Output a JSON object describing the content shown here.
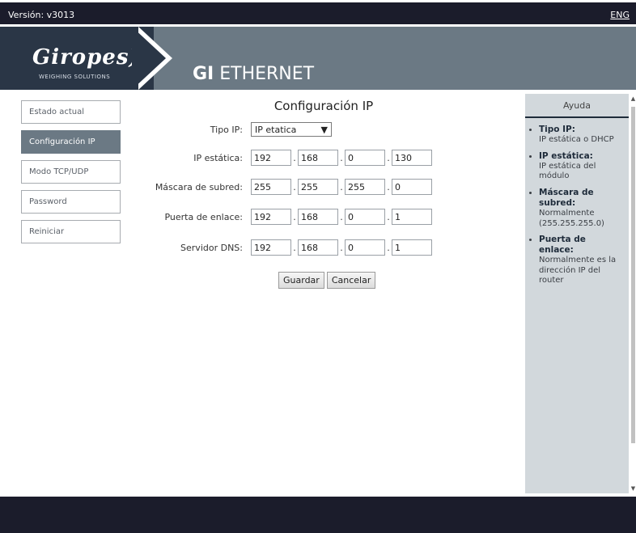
{
  "topbar": {
    "version": "Versión: v3013",
    "lang": "ENG"
  },
  "header": {
    "logo": "Giropes)",
    "logo_sub": "WEIGHING SOLUTIONS",
    "title_bold": "GI",
    "title_rest": " ETHERNET"
  },
  "sidebar": {
    "items": [
      {
        "label": "Estado actual"
      },
      {
        "label": "Configuración IP"
      },
      {
        "label": "Modo TCP/UDP"
      },
      {
        "label": "Password"
      },
      {
        "label": "Reiniciar"
      }
    ]
  },
  "form": {
    "title": "Configuración IP",
    "tipo_label": "Tipo IP:",
    "tipo_value": "IP etatica",
    "ip_label": "IP estática:",
    "ip": [
      "192",
      "168",
      "0",
      "130"
    ],
    "mask_label": "Máscara de subred:",
    "mask": [
      "255",
      "255",
      "255",
      "0"
    ],
    "gw_label": "Puerta de enlace:",
    "gw": [
      "192",
      "168",
      "0",
      "1"
    ],
    "dns_label": "Servidor DNS:",
    "dns": [
      "192",
      "168",
      "0",
      "1"
    ],
    "save": "Guardar",
    "cancel": "Cancelar"
  },
  "help": {
    "title": "Ayuda",
    "items": [
      {
        "term": "Tipo IP:",
        "desc": "IP estática o DHCP"
      },
      {
        "term": "IP estática:",
        "desc": "IP estática del módulo"
      },
      {
        "term": "Máscara de subred:",
        "desc": "Normalmente (255.255.255.0)"
      },
      {
        "term": "Puerta de enlace:",
        "desc": "Normalmente es la dirección IP del router"
      }
    ]
  },
  "colors": {
    "dark": "#1b1c2b",
    "header": "#6b7984",
    "logo_bg": "#2a3646",
    "help_bg": "#d2d8dc"
  }
}
